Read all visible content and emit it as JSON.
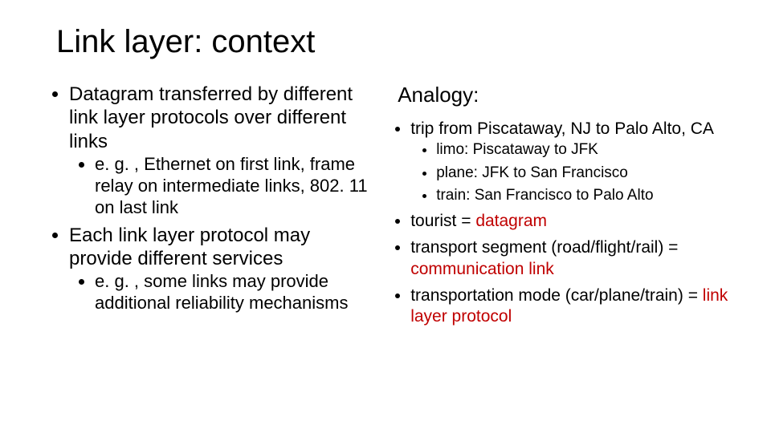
{
  "title": "Link layer: context",
  "left": {
    "b1": "Datagram transferred by different link layer protocols over different links",
    "b1a": "e. g. , Ethernet on first link, frame relay on intermediate links, 802. 11 on last link",
    "b2": "Each link layer protocol may provide different services",
    "b2a": "e. g. , some links may provide additional reliability mechanisms"
  },
  "right": {
    "heading": "Analogy:",
    "b1": "trip from Piscataway, NJ to Palo Alto, CA",
    "b1a": "limo: Piscataway to JFK",
    "b1b": "plane: JFK to San Francisco",
    "b1c": "train: San Francisco to Palo Alto",
    "b2_a": "tourist = ",
    "b2_b": "datagram",
    "b3_a": "transport segment (road/flight/rail) = ",
    "b3_b": "communication link",
    "b4_a": "transportation mode (car/plane/train) = ",
    "b4_b": "link layer protocol"
  }
}
